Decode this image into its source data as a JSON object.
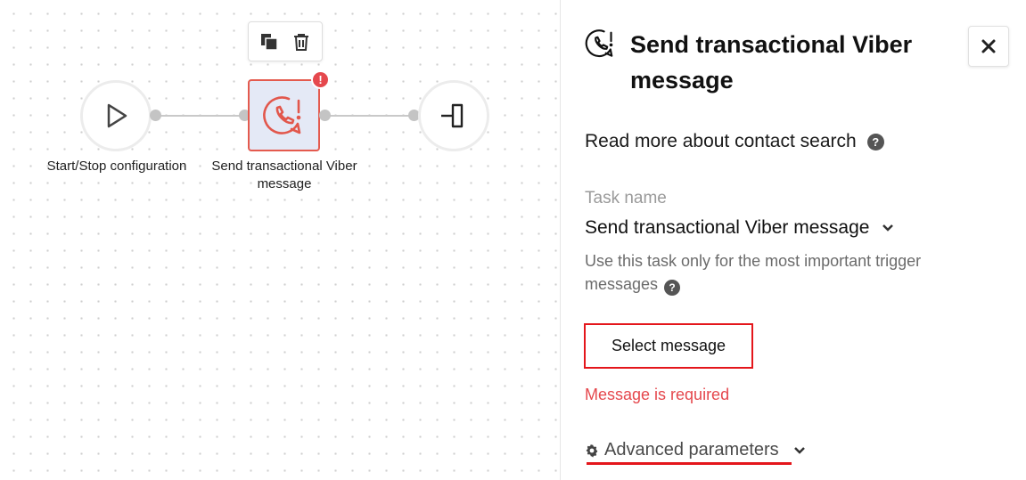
{
  "canvas": {
    "toolbar": {
      "copy_icon": "copy-icon",
      "delete_icon": "trash-icon"
    },
    "nodes": [
      {
        "label": "Start/Stop configuration",
        "icon": "play-icon"
      },
      {
        "label": "Send transactional Viber message",
        "icon": "viber-phone-icon",
        "badge": "!"
      },
      {
        "label": "",
        "icon": "exit-icon"
      }
    ]
  },
  "panel": {
    "title": "Send transactional Viber message",
    "title_icon": "viber-phone-icon",
    "close_label": "✕",
    "read_more": "Read more about contact search",
    "help": "?",
    "task_name_label": "Task name",
    "task_name_value": "Send transactional Viber message",
    "hint": "Use this task only for the most important trigger messages",
    "select_message": "Select message",
    "error": "Message is required",
    "advanced": "Advanced parameters"
  },
  "colors": {
    "error": "#e5484d",
    "highlight": "#e4161b",
    "node_fill": "#e4e9f6"
  }
}
